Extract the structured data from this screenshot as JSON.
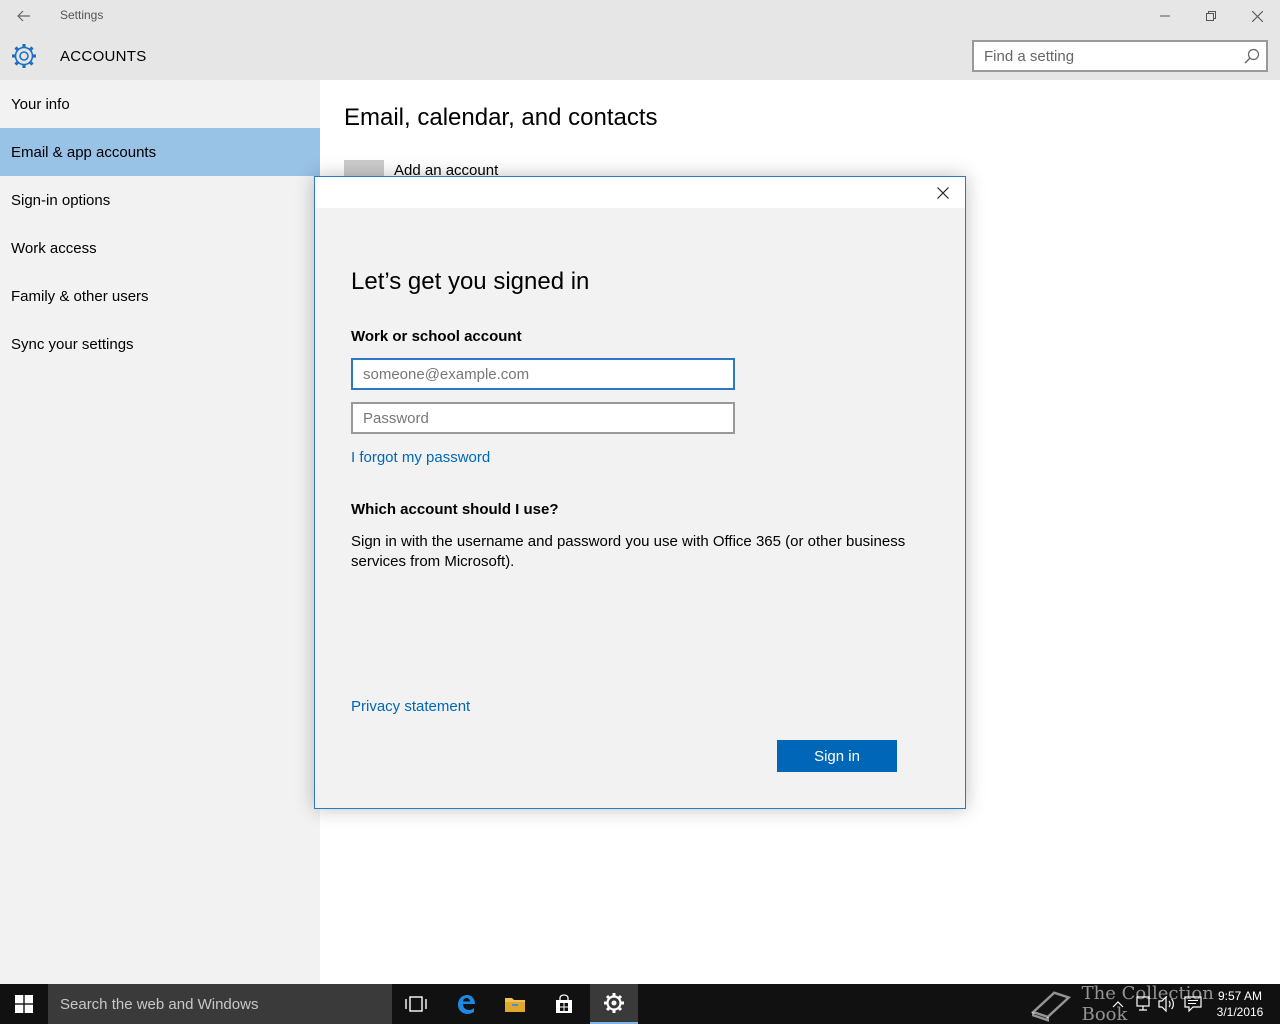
{
  "window": {
    "title": "Settings"
  },
  "header": {
    "title": "ACCOUNTS",
    "search_placeholder": "Find a setting"
  },
  "sidebar": {
    "items": [
      {
        "label": "Your info",
        "selected": false
      },
      {
        "label": "Email & app accounts",
        "selected": true
      },
      {
        "label": "Sign-in options",
        "selected": false
      },
      {
        "label": "Work access",
        "selected": false
      },
      {
        "label": "Family & other users",
        "selected": false
      },
      {
        "label": "Sync your settings",
        "selected": false
      }
    ]
  },
  "main": {
    "title": "Email, calendar, and contacts",
    "add_account_label": "Add an account"
  },
  "dialog": {
    "heading": "Let’s get you signed in",
    "account_label": "Work or school account",
    "email_placeholder": "someone@example.com",
    "password_placeholder": "Password",
    "forgot_link": "I forgot my password",
    "which_heading": "Which account should I use?",
    "description": "Sign in with the username and password you use with Office 365 (or other business services from Microsoft).",
    "privacy_link": "Privacy statement",
    "sign_in_label": "Sign in"
  },
  "taskbar": {
    "search_placeholder": "Search the web and Windows",
    "watermark": "The Collection Book",
    "time": "9:57 AM",
    "date": "3/1/2016"
  },
  "colors": {
    "accent": "#0067b8",
    "selected_nav": "#99c2e7",
    "sidebar_bg": "#f2f2f2",
    "titlebar_bg": "#e6e6e6"
  }
}
